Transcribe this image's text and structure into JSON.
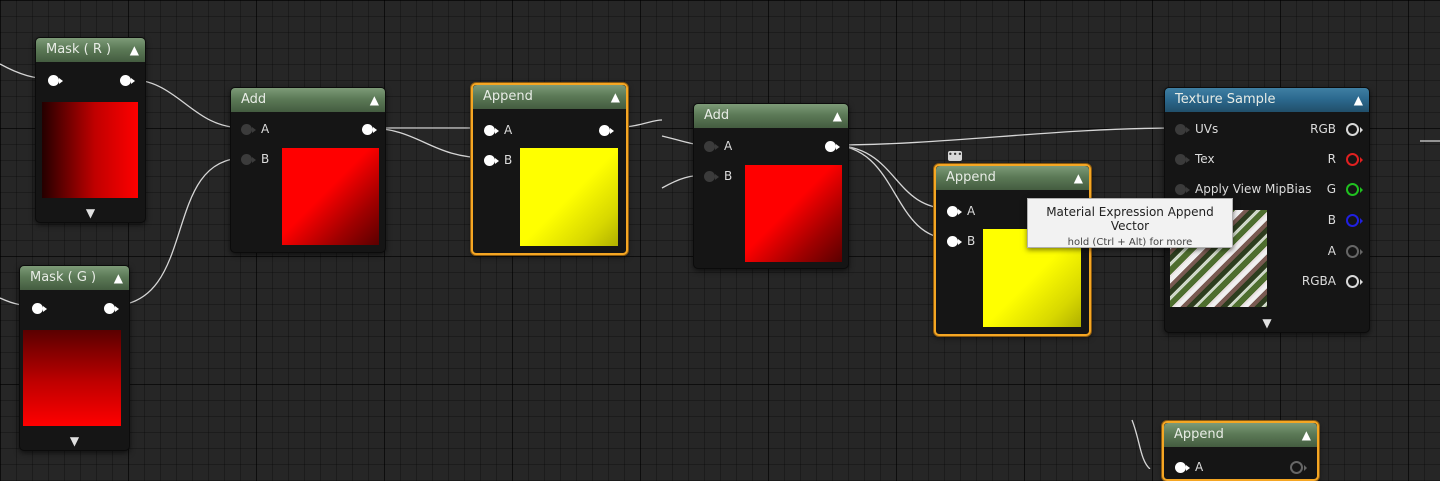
{
  "nodes": {
    "mask_r": {
      "title": "Mask ( R )"
    },
    "mask_g": {
      "title": "Mask ( G )"
    },
    "add1": {
      "title": "Add",
      "pin_a": "A",
      "pin_b": "B"
    },
    "append1": {
      "title": "Append",
      "pin_a": "A",
      "pin_b": "B"
    },
    "add2": {
      "title": "Add",
      "pin_a": "A",
      "pin_b": "B"
    },
    "append2": {
      "title": "Append",
      "pin_a": "A",
      "pin_b": "B"
    },
    "texture_sample": {
      "title": "Texture Sample",
      "inputs": [
        "UVs",
        "Tex",
        "Apply View MipBias"
      ],
      "outputs": [
        "RGB",
        "R",
        "G",
        "B",
        "A",
        "RGBA"
      ]
    },
    "append3": {
      "title": "Append",
      "pin_a": "A"
    }
  },
  "tooltip": {
    "title": "Material Expression Append Vector",
    "hint": "hold (Ctrl + Alt) for more"
  },
  "icons": {
    "collapse": "chevron-up-icon",
    "expand": "chevron-down-icon",
    "comment": "comment-bubble-icon"
  },
  "colors": {
    "material_header": "#5c7a57",
    "texture_header": "#2c6a8f",
    "selection": "#f5a623",
    "red_channel": "#e02020",
    "green_channel": "#20c020",
    "blue_channel": "#2020e0"
  }
}
